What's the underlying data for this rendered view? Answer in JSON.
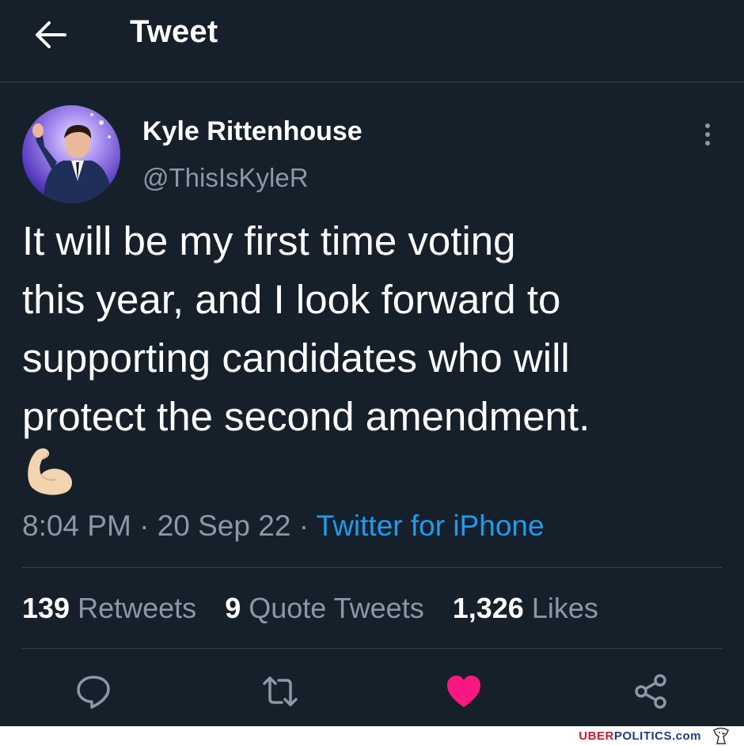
{
  "header": {
    "title": "Tweet",
    "back_icon": "arrow-left-icon"
  },
  "author": {
    "name": "Kyle Rittenhouse",
    "handle": "@ThisIsKyleR"
  },
  "tweet": {
    "text": "It will be my first time voting\nthis year, and I look forward to\nsupporting candidates who will\nprotect the second amendment.",
    "emoji": "flexed-biceps-icon"
  },
  "meta": {
    "time": "8:04 PM",
    "separator": "·",
    "date": "20 Sep 22",
    "source": "Twitter for iPhone"
  },
  "stats": {
    "retweets_count": "139",
    "retweets_label": "Retweets",
    "quotes_count": "9",
    "quotes_label": "Quote Tweets",
    "likes_count": "1,326",
    "likes_label": "Likes"
  },
  "actions": [
    "reply-icon",
    "retweet-icon",
    "like-icon",
    "share-icon"
  ],
  "colors": {
    "background": "#15202b",
    "secondary_text": "#8b98a5",
    "link": "#1d9bf0",
    "like": "#f91880",
    "divider": "#38444d"
  },
  "watermark": {
    "uber": "UBER",
    "politics": "POLITICS",
    "dotcom": ".com"
  }
}
